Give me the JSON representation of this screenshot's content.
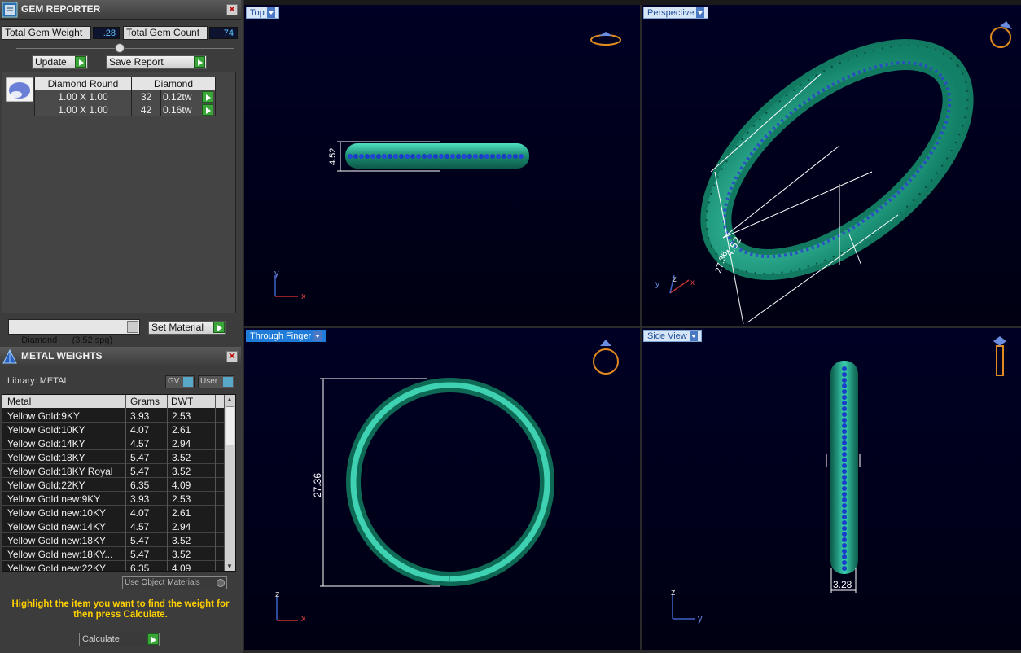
{
  "gem_reporter": {
    "title": "GEM REPORTER",
    "total_weight_label": "Total Gem Weight",
    "total_weight_value": ".28",
    "total_count_label": "Total Gem Count",
    "total_count_value": "74",
    "update_label": "Update",
    "save_report_label": "Save Report",
    "table_headers": [
      "Diamond Round",
      "Diamond"
    ],
    "rows": [
      {
        "size": "1.00 X 1.00",
        "count": "32",
        "weight": "0.12tw"
      },
      {
        "size": "1.00 X 1.00",
        "count": "42",
        "weight": "0.16tw"
      }
    ],
    "material_select": "Diamond      (3.52 spg)",
    "set_material_label": "Set Material"
  },
  "metal_weights": {
    "title": "METAL WEIGHTS",
    "library_label": "Library: METAL",
    "gv_label": "GV",
    "user_label": "User",
    "headers": [
      "Metal",
      "Grams",
      "DWT"
    ],
    "rows": [
      {
        "metal": "Yellow Gold:9KY",
        "grams": "3.93",
        "dwt": "2.53"
      },
      {
        "metal": "Yellow Gold:10KY",
        "grams": "4.07",
        "dwt": "2.61"
      },
      {
        "metal": "Yellow Gold:14KY",
        "grams": "4.57",
        "dwt": "2.94"
      },
      {
        "metal": "Yellow Gold:18KY",
        "grams": "5.47",
        "dwt": "3.52"
      },
      {
        "metal": "Yellow Gold:18KY Royal",
        "grams": "5.47",
        "dwt": "3.52"
      },
      {
        "metal": "Yellow Gold:22KY",
        "grams": "6.35",
        "dwt": "4.09"
      },
      {
        "metal": "Yellow Gold new:9KY",
        "grams": "3.93",
        "dwt": "2.53"
      },
      {
        "metal": "Yellow Gold new:10KY",
        "grams": "4.07",
        "dwt": "2.61"
      },
      {
        "metal": "Yellow Gold new:14KY",
        "grams": "4.57",
        "dwt": "2.94"
      },
      {
        "metal": "Yellow Gold new:18KY",
        "grams": "5.47",
        "dwt": "3.52"
      },
      {
        "metal": "Yellow Gold new:18KY...",
        "grams": "5.47",
        "dwt": "3.52"
      },
      {
        "metal": "Yellow Gold new:22KY",
        "grams": "6.35",
        "dwt": "4.09"
      }
    ],
    "use_object_materials_label": "Use Object Materials",
    "hint": "Highlight the item you want to find the weight for then press Calculate.",
    "calculate_label": "Calculate"
  },
  "viewports": {
    "top_label": "Top",
    "perspective_label": "Perspective",
    "through_finger_label": "Through Finger",
    "side_view_label": "Side View",
    "top_dim": "4.52",
    "persp_dim1": "4.52",
    "persp_dim2": "27.36",
    "finger_dim": "27.36",
    "side_dim": "3.28",
    "axis_x": "x",
    "axis_y": "y",
    "axis_z": "z"
  },
  "colors": {
    "ring_metal": "#1fa58a",
    "gem_blue": "#1a3cc8",
    "dimension_line": "#ffffff",
    "hint_text": "#ffd000"
  }
}
